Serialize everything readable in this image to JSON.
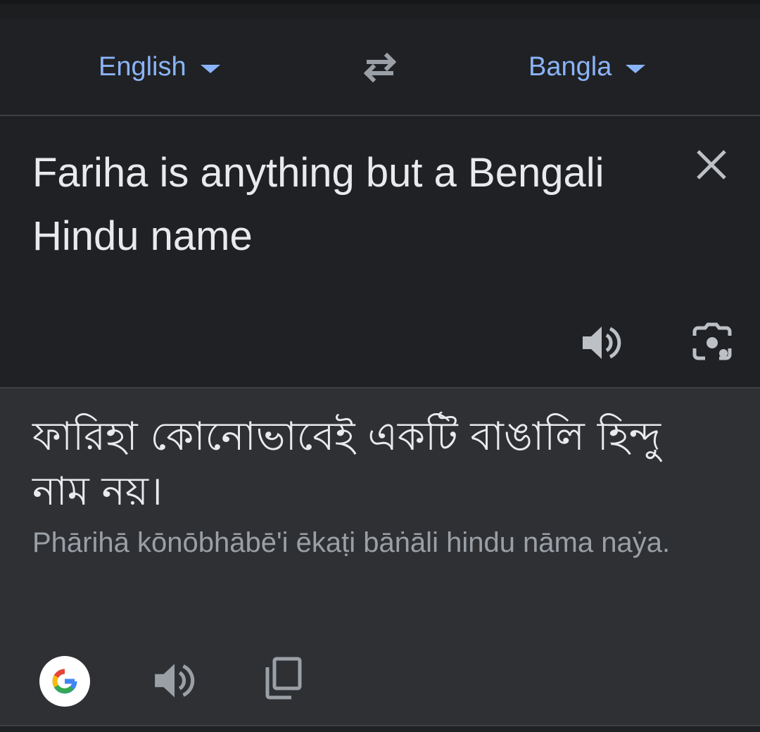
{
  "language_bar": {
    "source_language": "English",
    "target_language": "Bangla"
  },
  "input": {
    "text": "Fariha is anything but a Bengali Hindu name"
  },
  "output": {
    "translation": "ফারিহা কোনোভাবেই একটি বাঙালি হিন্দু নাম নয়।",
    "transliteration": "Phārihā kōnōbhābē'i ēkaṭi bāṅāli hindu nāma naẏa."
  },
  "icons": {
    "swap": "swap-languages-icon",
    "clear": "close-icon",
    "speak": "speaker-icon",
    "camera": "camera-icon",
    "google": "google-logo-icon",
    "copy": "copy-icon"
  },
  "colors": {
    "accent": "#8ab4f8",
    "background": "#202124",
    "output_background": "#2f3034",
    "text": "#e8eaed",
    "secondary_text": "#9aa0a6"
  }
}
